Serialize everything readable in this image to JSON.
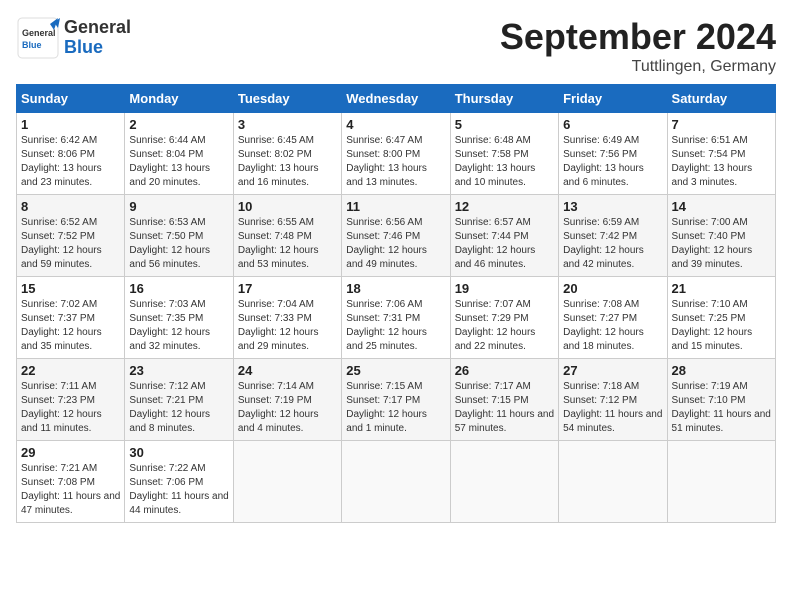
{
  "header": {
    "logo_general": "General",
    "logo_blue": "Blue",
    "month": "September 2024",
    "location": "Tuttlingen, Germany"
  },
  "weekdays": [
    "Sunday",
    "Monday",
    "Tuesday",
    "Wednesday",
    "Thursday",
    "Friday",
    "Saturday"
  ],
  "weeks": [
    [
      {
        "day": "1",
        "sunrise": "Sunrise: 6:42 AM",
        "sunset": "Sunset: 8:06 PM",
        "daylight": "Daylight: 13 hours and 23 minutes."
      },
      {
        "day": "2",
        "sunrise": "Sunrise: 6:44 AM",
        "sunset": "Sunset: 8:04 PM",
        "daylight": "Daylight: 13 hours and 20 minutes."
      },
      {
        "day": "3",
        "sunrise": "Sunrise: 6:45 AM",
        "sunset": "Sunset: 8:02 PM",
        "daylight": "Daylight: 13 hours and 16 minutes."
      },
      {
        "day": "4",
        "sunrise": "Sunrise: 6:47 AM",
        "sunset": "Sunset: 8:00 PM",
        "daylight": "Daylight: 13 hours and 13 minutes."
      },
      {
        "day": "5",
        "sunrise": "Sunrise: 6:48 AM",
        "sunset": "Sunset: 7:58 PM",
        "daylight": "Daylight: 13 hours and 10 minutes."
      },
      {
        "day": "6",
        "sunrise": "Sunrise: 6:49 AM",
        "sunset": "Sunset: 7:56 PM",
        "daylight": "Daylight: 13 hours and 6 minutes."
      },
      {
        "day": "7",
        "sunrise": "Sunrise: 6:51 AM",
        "sunset": "Sunset: 7:54 PM",
        "daylight": "Daylight: 13 hours and 3 minutes."
      }
    ],
    [
      {
        "day": "8",
        "sunrise": "Sunrise: 6:52 AM",
        "sunset": "Sunset: 7:52 PM",
        "daylight": "Daylight: 12 hours and 59 minutes."
      },
      {
        "day": "9",
        "sunrise": "Sunrise: 6:53 AM",
        "sunset": "Sunset: 7:50 PM",
        "daylight": "Daylight: 12 hours and 56 minutes."
      },
      {
        "day": "10",
        "sunrise": "Sunrise: 6:55 AM",
        "sunset": "Sunset: 7:48 PM",
        "daylight": "Daylight: 12 hours and 53 minutes."
      },
      {
        "day": "11",
        "sunrise": "Sunrise: 6:56 AM",
        "sunset": "Sunset: 7:46 PM",
        "daylight": "Daylight: 12 hours and 49 minutes."
      },
      {
        "day": "12",
        "sunrise": "Sunrise: 6:57 AM",
        "sunset": "Sunset: 7:44 PM",
        "daylight": "Daylight: 12 hours and 46 minutes."
      },
      {
        "day": "13",
        "sunrise": "Sunrise: 6:59 AM",
        "sunset": "Sunset: 7:42 PM",
        "daylight": "Daylight: 12 hours and 42 minutes."
      },
      {
        "day": "14",
        "sunrise": "Sunrise: 7:00 AM",
        "sunset": "Sunset: 7:40 PM",
        "daylight": "Daylight: 12 hours and 39 minutes."
      }
    ],
    [
      {
        "day": "15",
        "sunrise": "Sunrise: 7:02 AM",
        "sunset": "Sunset: 7:37 PM",
        "daylight": "Daylight: 12 hours and 35 minutes."
      },
      {
        "day": "16",
        "sunrise": "Sunrise: 7:03 AM",
        "sunset": "Sunset: 7:35 PM",
        "daylight": "Daylight: 12 hours and 32 minutes."
      },
      {
        "day": "17",
        "sunrise": "Sunrise: 7:04 AM",
        "sunset": "Sunset: 7:33 PM",
        "daylight": "Daylight: 12 hours and 29 minutes."
      },
      {
        "day": "18",
        "sunrise": "Sunrise: 7:06 AM",
        "sunset": "Sunset: 7:31 PM",
        "daylight": "Daylight: 12 hours and 25 minutes."
      },
      {
        "day": "19",
        "sunrise": "Sunrise: 7:07 AM",
        "sunset": "Sunset: 7:29 PM",
        "daylight": "Daylight: 12 hours and 22 minutes."
      },
      {
        "day": "20",
        "sunrise": "Sunrise: 7:08 AM",
        "sunset": "Sunset: 7:27 PM",
        "daylight": "Daylight: 12 hours and 18 minutes."
      },
      {
        "day": "21",
        "sunrise": "Sunrise: 7:10 AM",
        "sunset": "Sunset: 7:25 PM",
        "daylight": "Daylight: 12 hours and 15 minutes."
      }
    ],
    [
      {
        "day": "22",
        "sunrise": "Sunrise: 7:11 AM",
        "sunset": "Sunset: 7:23 PM",
        "daylight": "Daylight: 12 hours and 11 minutes."
      },
      {
        "day": "23",
        "sunrise": "Sunrise: 7:12 AM",
        "sunset": "Sunset: 7:21 PM",
        "daylight": "Daylight: 12 hours and 8 minutes."
      },
      {
        "day": "24",
        "sunrise": "Sunrise: 7:14 AM",
        "sunset": "Sunset: 7:19 PM",
        "daylight": "Daylight: 12 hours and 4 minutes."
      },
      {
        "day": "25",
        "sunrise": "Sunrise: 7:15 AM",
        "sunset": "Sunset: 7:17 PM",
        "daylight": "Daylight: 12 hours and 1 minute."
      },
      {
        "day": "26",
        "sunrise": "Sunrise: 7:17 AM",
        "sunset": "Sunset: 7:15 PM",
        "daylight": "Daylight: 11 hours and 57 minutes."
      },
      {
        "day": "27",
        "sunrise": "Sunrise: 7:18 AM",
        "sunset": "Sunset: 7:12 PM",
        "daylight": "Daylight: 11 hours and 54 minutes."
      },
      {
        "day": "28",
        "sunrise": "Sunrise: 7:19 AM",
        "sunset": "Sunset: 7:10 PM",
        "daylight": "Daylight: 11 hours and 51 minutes."
      }
    ],
    [
      {
        "day": "29",
        "sunrise": "Sunrise: 7:21 AM",
        "sunset": "Sunset: 7:08 PM",
        "daylight": "Daylight: 11 hours and 47 minutes."
      },
      {
        "day": "30",
        "sunrise": "Sunrise: 7:22 AM",
        "sunset": "Sunset: 7:06 PM",
        "daylight": "Daylight: 11 hours and 44 minutes."
      },
      null,
      null,
      null,
      null,
      null
    ]
  ]
}
